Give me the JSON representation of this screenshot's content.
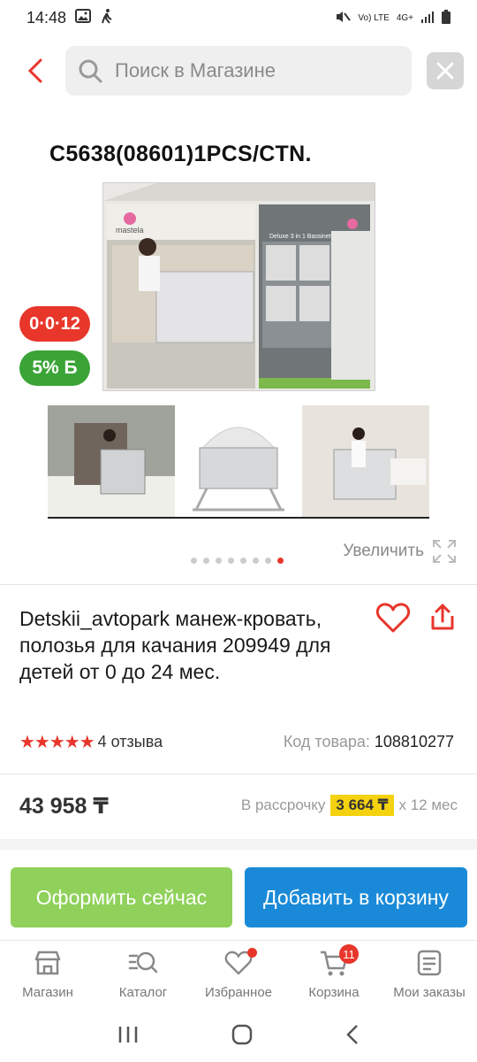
{
  "status_bar": {
    "time": "14:48",
    "net_label": "Vo) LTE",
    "net_speed": "4G+"
  },
  "search": {
    "placeholder": "Поиск в Магазине"
  },
  "gallery": {
    "image_caption": "C5638(08601)1PCS/CTN.",
    "box_brand": "mastela",
    "box_headline": "Deluxe 3 in 1 Bassinet",
    "badge_age": "0·0·12",
    "badge_cashback": "5% Б",
    "zoom_label": "Увеличить",
    "page_count": 8,
    "active_page": 8
  },
  "product": {
    "title": "Detskii_avtopark манеж-кровать, полозья для качания 209949 для детей от 0 до 24 мес.",
    "rating_stars": "★★★★★",
    "reviews": "4 отзыва",
    "code_label": "Код товара:",
    "code_value": "108810277",
    "price": "43 958 ₸",
    "installment_prefix": "В рассрочку",
    "installment_amount": "3 664 ₸",
    "installment_suffix": "x 12 мес"
  },
  "actions": {
    "buy_now": "Оформить сейчас",
    "add_to_cart": "Добавить в корзину"
  },
  "tabs": [
    {
      "label": "Магазин",
      "icon": "store-icon"
    },
    {
      "label": "Каталог",
      "icon": "catalog-search-icon"
    },
    {
      "label": "Избранное",
      "icon": "heart-icon"
    },
    {
      "label": "Корзина",
      "icon": "cart-icon",
      "badge": "11"
    },
    {
      "label": "Мои заказы",
      "icon": "orders-icon"
    }
  ],
  "colors": {
    "accent_red": "#e8362b",
    "buy_green": "#8fd15a",
    "cart_blue": "#1a8ad8",
    "installment_yellow": "#f5d20f"
  }
}
